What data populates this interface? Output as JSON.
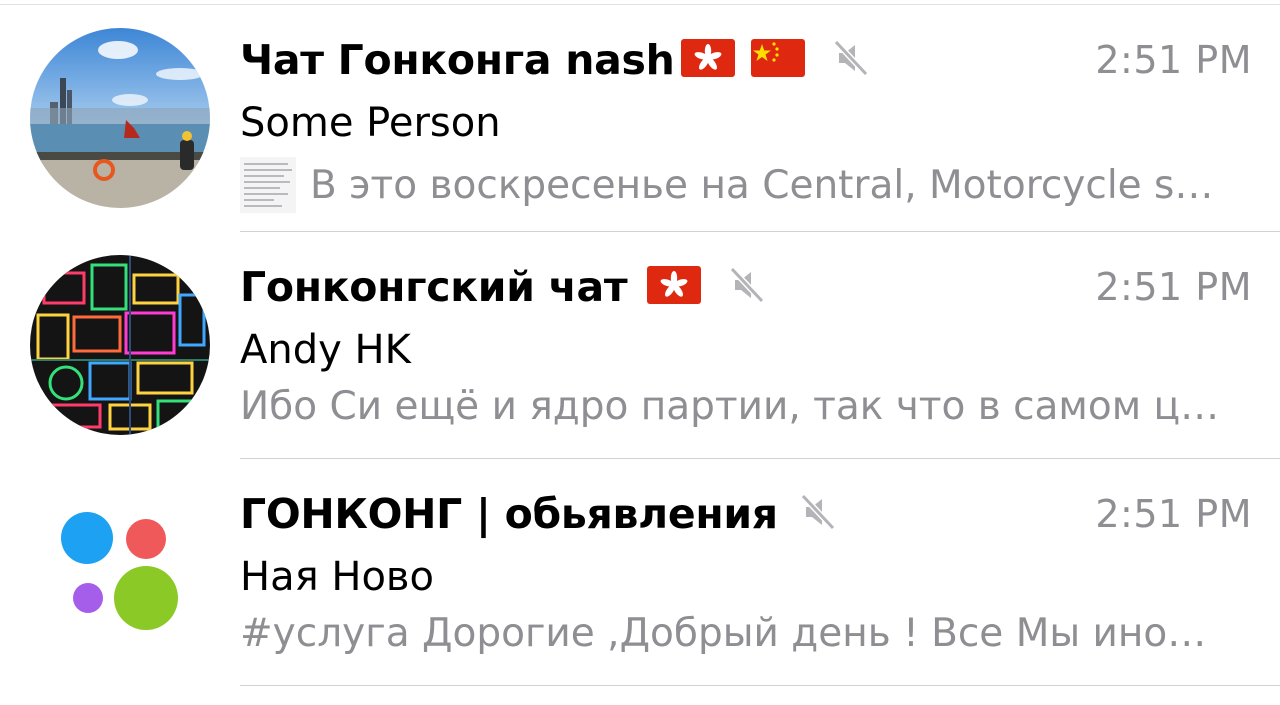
{
  "chats": [
    {
      "title": "Чат Гонконга nash",
      "flags": [
        "hong-kong-flag",
        "china-flag"
      ],
      "muted": true,
      "time": "2:51 PM",
      "sender": "Some Person",
      "preview": "В это воскресенье на Central, Motorcycle s…",
      "has_thumbnail": true,
      "avatar": "harbour-photo"
    },
    {
      "title": "Гонконгский чат",
      "flags": [
        "hong-kong-flag"
      ],
      "muted": true,
      "time": "2:51 PM",
      "sender": "Andy HK",
      "preview": "Ибо Си ещё и ядро партии, так что в самом ц…",
      "has_thumbnail": false,
      "avatar": "neon-signs"
    },
    {
      "title": "ГОНКОНГ | обьявления",
      "flags": [],
      "muted": true,
      "time": "2:51 PM",
      "sender": "Ная Ново",
      "preview": "#услуга  Дорогие ,Добрый день ! Все Мы ино…",
      "has_thumbnail": false,
      "avatar": "colored-dots-logo"
    }
  ],
  "colors": {
    "title": "#000000",
    "secondary": "#8e8e93",
    "separator": "#d1d1d6",
    "hk_flag": "#de2910",
    "dot_blue": "#1da1f2",
    "dot_red": "#f0595a",
    "dot_purple": "#a55eea",
    "dot_green": "#8ac926"
  }
}
